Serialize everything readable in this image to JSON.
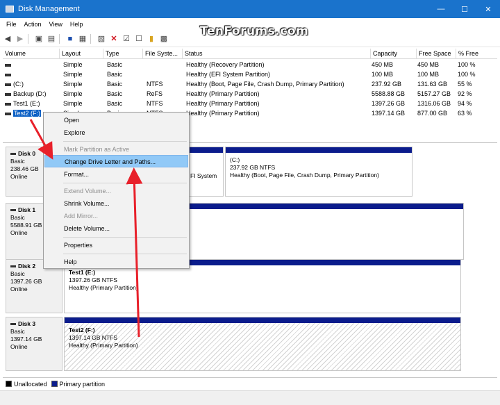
{
  "window": {
    "title": "Disk Management",
    "min": "—",
    "max": "☐",
    "close": "✕"
  },
  "menu": [
    "File",
    "Action",
    "View",
    "Help"
  ],
  "watermark": "TenForums.com",
  "columns": [
    "Volume",
    "Layout",
    "Type",
    "File Syste...",
    "Status",
    "Capacity",
    "Free Space",
    "% Free"
  ],
  "volumes": [
    {
      "volume": "",
      "layout": "Simple",
      "type": "Basic",
      "fs": "",
      "status": "Healthy (Recovery Partition)",
      "capacity": "450 MB",
      "free": "450 MB",
      "pct": "100 %"
    },
    {
      "volume": "",
      "layout": "Simple",
      "type": "Basic",
      "fs": "",
      "status": "Healthy (EFI System Partition)",
      "capacity": "100 MB",
      "free": "100 MB",
      "pct": "100 %"
    },
    {
      "volume": "(C:)",
      "layout": "Simple",
      "type": "Basic",
      "fs": "NTFS",
      "status": "Healthy (Boot, Page File, Crash Dump, Primary Partition)",
      "capacity": "237.92 GB",
      "free": "131.63 GB",
      "pct": "55 %"
    },
    {
      "volume": "Backup (D:)",
      "layout": "Simple",
      "type": "Basic",
      "fs": "ReFS",
      "status": "Healthy (Primary Partition)",
      "capacity": "5588.88 GB",
      "free": "5157.27 GB",
      "pct": "92 %"
    },
    {
      "volume": "Test1 (E:)",
      "layout": "Simple",
      "type": "Basic",
      "fs": "NTFS",
      "status": "Healthy (Primary Partition)",
      "capacity": "1397.26 GB",
      "free": "1316.06 GB",
      "pct": "94 %"
    },
    {
      "volume": "Test2 (F:)",
      "layout": "Simple",
      "type": "Basic",
      "fs": "NTFS",
      "status": "Healthy (Primary Partition)",
      "capacity": "1397.14 GB",
      "free": "877.00 GB",
      "pct": "63 %"
    }
  ],
  "disks": [
    {
      "name": "Disk 0",
      "type": "Basic",
      "size": "238.46 GB",
      "state": "Online"
    },
    {
      "name": "Disk 1",
      "type": "Basic",
      "size": "5588.91 GB",
      "state": "Online"
    },
    {
      "name": "Disk 2",
      "type": "Basic",
      "size": "1397.26 GB",
      "state": "Online"
    },
    {
      "name": "Disk 3",
      "type": "Basic",
      "size": "1397.14 GB",
      "state": "Online"
    }
  ],
  "partitions": {
    "disk0_efi_fragment": "FI System",
    "disk0_c": {
      "name": "(C:)",
      "size": "237.92 GB NTFS",
      "status": "Healthy (Boot, Page File, Crash Dump, Primary Partition)"
    },
    "disk2_e": {
      "name": "Test1  (E:)",
      "size": "1397.26 GB NTFS",
      "status": "Healthy (Primary Partition)"
    },
    "disk3_f": {
      "name": "Test2  (F:)",
      "size": "1397.14 GB NTFS",
      "status": "Healthy (Primary Partition)"
    }
  },
  "context_menu": {
    "open": "Open",
    "explore": "Explore",
    "mark_active": "Mark Partition as Active",
    "change_letter": "Change Drive Letter and Paths...",
    "format": "Format...",
    "extend": "Extend Volume...",
    "shrink": "Shrink Volume...",
    "add_mirror": "Add Mirror...",
    "delete": "Delete Volume...",
    "properties": "Properties",
    "help": "Help"
  },
  "legend": {
    "unallocated": "Unallocated",
    "primary": "Primary partition",
    "unallocated_color": "#000000",
    "primary_color": "#0b1c8c"
  },
  "colors": {
    "titlebar": "#1a73cc",
    "selection": "#0a5fc4",
    "menu_highlight": "#91c9f7",
    "arrow": "#e8202a"
  }
}
